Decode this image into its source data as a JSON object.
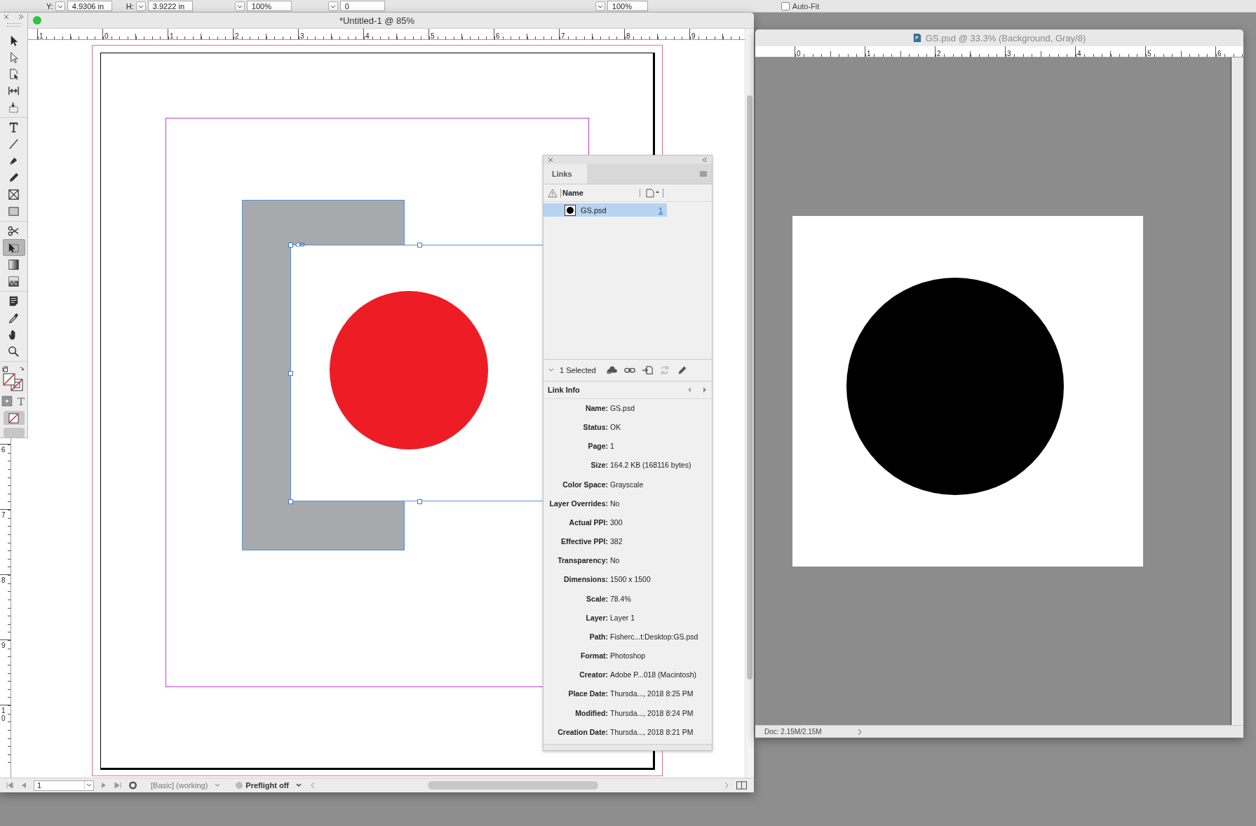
{
  "control_bar": {
    "fields": [
      {
        "label": "Y:",
        "value": "4.9306 in"
      },
      {
        "label": "H:",
        "value": "3.9222 in"
      },
      {
        "value": "100%"
      },
      {
        "value": "0"
      },
      {
        "value": "100%"
      }
    ],
    "auto_fit": {
      "label": "Auto-Fit",
      "checked": false
    }
  },
  "tools": [
    [
      {
        "kind": "selection",
        "selected": false
      },
      {
        "kind": "direct_selection",
        "selected": false
      },
      {
        "kind": "page",
        "selected": false
      },
      {
        "kind": "gap",
        "selected": false
      },
      {
        "kind": "content_collector",
        "selected": false
      }
    ],
    [
      {
        "kind": "type",
        "selected": false
      },
      {
        "kind": "line",
        "selected": false
      },
      {
        "kind": "pen",
        "selected": false
      },
      {
        "kind": "pencil",
        "selected": false
      },
      {
        "kind": "rectangle_frame",
        "selected": false
      },
      {
        "kind": "rectangle",
        "selected": false
      }
    ],
    [
      {
        "kind": "scissors",
        "selected": false
      },
      {
        "kind": "free_transform",
        "selected": true
      },
      {
        "kind": "gradient_swatch",
        "selected": false
      },
      {
        "kind": "gradient_feather",
        "selected": false
      }
    ],
    [
      {
        "kind": "note",
        "selected": false
      },
      {
        "kind": "eyedropper",
        "selected": false
      },
      {
        "kind": "hand",
        "selected": false
      },
      {
        "kind": "zoom",
        "selected": false
      }
    ]
  ],
  "indesign_window": {
    "title": "*Untitled-1 @ 85%",
    "ruler_numbers": [
      "1",
      "0",
      "1",
      "2",
      "3",
      "4",
      "5",
      "6",
      "7",
      "8",
      "9"
    ],
    "vertical_ruler_numbers": [
      "6",
      "7",
      "8",
      "9",
      "10"
    ]
  },
  "status_bar": {
    "page": "1",
    "profile": "[Basic] (working)",
    "preflight": "Preflight off"
  },
  "links_panel": {
    "tab": "Links",
    "name_column": "Name",
    "links": [
      {
        "name": "GS.psd",
        "page": "1",
        "selected": true
      }
    ],
    "selection_count": "1 Selected",
    "actions": [
      {
        "kind": "cloud",
        "disabled": false
      },
      {
        "kind": "relink",
        "disabled": false
      },
      {
        "kind": "goto",
        "disabled": false
      },
      {
        "kind": "update",
        "disabled": true
      },
      {
        "kind": "edit",
        "disabled": false
      }
    ],
    "info_title": "Link Info",
    "info": [
      {
        "label": "Name:",
        "value": "GS.psd"
      },
      {
        "label": "Status:",
        "value": "OK"
      },
      {
        "label": "Page:",
        "value": "1"
      },
      {
        "label": "Size:",
        "value": "164.2 KB (168116 bytes)"
      },
      {
        "label": "Color Space:",
        "value": "Grayscale"
      },
      {
        "label": "Layer Overrides:",
        "value": "No"
      },
      {
        "label": "Actual PPI:",
        "value": "300"
      },
      {
        "label": "Effective PPI:",
        "value": "382"
      },
      {
        "label": "Transparency:",
        "value": "No"
      },
      {
        "label": "Dimensions:",
        "value": "1500 x 1500"
      },
      {
        "label": "Scale:",
        "value": "78.4%"
      },
      {
        "label": "Layer:",
        "value": "Layer 1"
      },
      {
        "label": "Path:",
        "value": "Fisherc...t:Desktop:GS.psd"
      },
      {
        "label": "Format:",
        "value": "Photoshop"
      },
      {
        "label": "Creator:",
        "value": "Adobe P...018 (Macintosh)"
      },
      {
        "label": "Place Date:",
        "value": "Thursda..., 2018 8:25 PM"
      },
      {
        "label": "Modified:",
        "value": "Thursda..., 2018 8:24 PM"
      },
      {
        "label": "Creation Date:",
        "value": "Thursda..., 2018 8:21 PM"
      }
    ]
  },
  "photoshop_window": {
    "title": "GS.psd @ 33.3% (Background, Gray/8)",
    "ruler_numbers": [
      "0",
      "1",
      "2",
      "3",
      "4",
      "5",
      "6"
    ],
    "status": "Doc: 2.15M/2.15M"
  }
}
